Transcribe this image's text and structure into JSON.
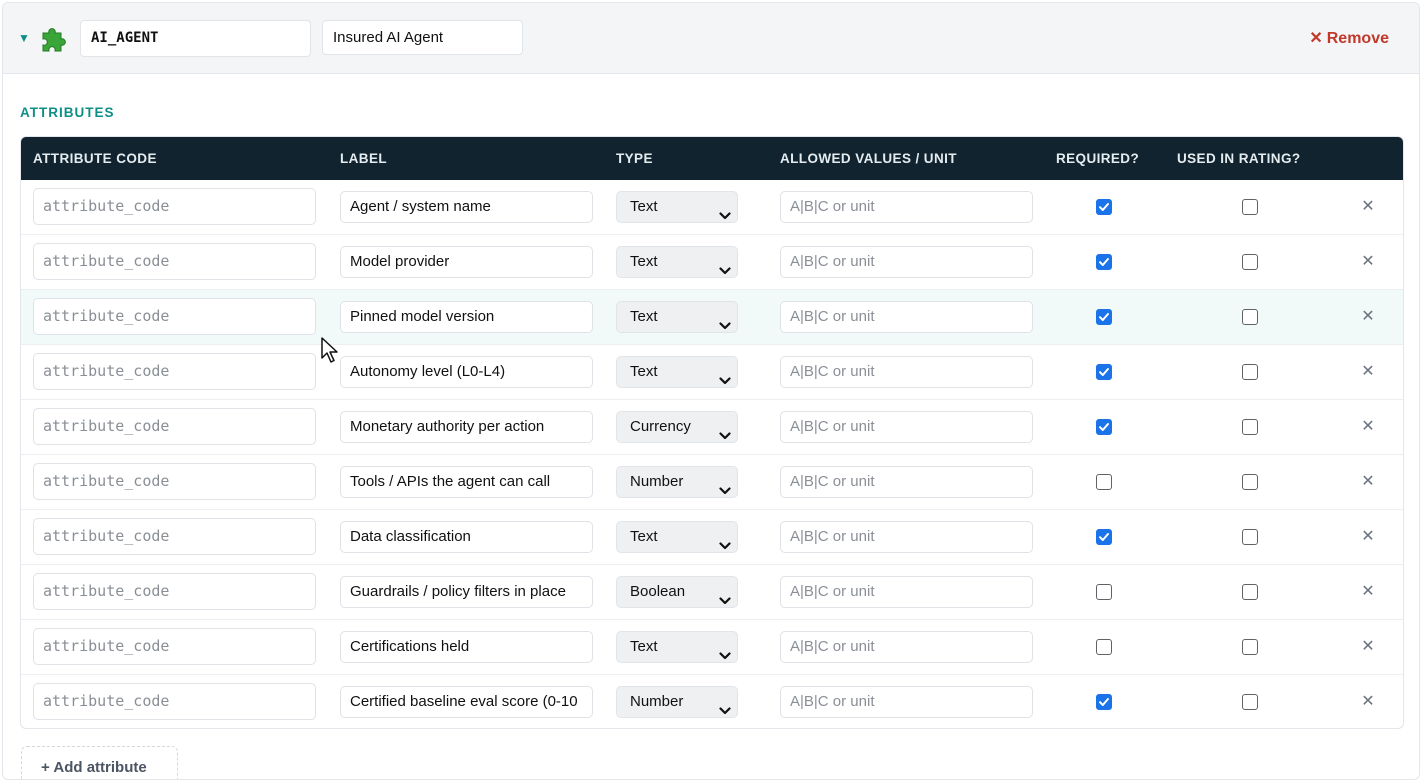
{
  "entity": {
    "expand_icon": "triangle-down-icon",
    "type_icon": "puzzle-piece-icon",
    "code": "AI_AGENT",
    "name": "Insured AI Agent",
    "remove_label": "Remove",
    "remove_icon": "close-icon"
  },
  "attributes_section": {
    "title": "ATTRIBUTES",
    "columns": [
      "ATTRIBUTE CODE",
      "LABEL",
      "TYPE",
      "ALLOWED VALUES / UNIT",
      "REQUIRED?",
      "USED IN RATING?"
    ],
    "rows": [
      {
        "code_placeholder": "attribute_code",
        "label": "Agent / system name",
        "type": "Text",
        "allowed_placeholder": "A|B|C or unit",
        "required": true,
        "used_in_rating": false
      },
      {
        "code_placeholder": "attribute_code",
        "label": "Model provider",
        "type": "Text",
        "allowed_placeholder": "A|B|C or unit",
        "required": true,
        "used_in_rating": false
      },
      {
        "code_placeholder": "attribute_code",
        "label": "Pinned model version",
        "type": "Text",
        "allowed_placeholder": "A|B|C or unit",
        "required": true,
        "used_in_rating": false
      },
      {
        "code_placeholder": "attribute_code",
        "label": "Autonomy level (L0-L4)",
        "type": "Text",
        "allowed_placeholder": "A|B|C or unit",
        "required": true,
        "used_in_rating": false
      },
      {
        "code_placeholder": "attribute_code",
        "label": "Monetary authority per action",
        "type": "Currency",
        "allowed_placeholder": "A|B|C or unit",
        "required": true,
        "used_in_rating": false
      },
      {
        "code_placeholder": "attribute_code",
        "label": "Tools / APIs the agent can call",
        "type": "Number",
        "allowed_placeholder": "A|B|C or unit",
        "required": false,
        "used_in_rating": false
      },
      {
        "code_placeholder": "attribute_code",
        "label": "Data classification",
        "type": "Text",
        "allowed_placeholder": "A|B|C or unit",
        "required": true,
        "used_in_rating": false
      },
      {
        "code_placeholder": "attribute_code",
        "label": "Guardrails / policy filters in place",
        "type": "Boolean",
        "allowed_placeholder": "A|B|C or unit",
        "required": false,
        "used_in_rating": false
      },
      {
        "code_placeholder": "attribute_code",
        "label": "Certifications held",
        "type": "Text",
        "allowed_placeholder": "A|B|C or unit",
        "required": false,
        "used_in_rating": false
      },
      {
        "code_placeholder": "attribute_code",
        "label": "Certified baseline eval score (0-10",
        "type": "Number",
        "allowed_placeholder": "A|B|C or unit",
        "required": true,
        "used_in_rating": false
      }
    ],
    "row_delete_icon": "close-icon",
    "add_label": "+ Add attribute"
  },
  "colors": {
    "accent": "#0e8f86",
    "header_bg": "#11232e",
    "remove": "#c0392b",
    "checkbox": "#1a73e8"
  }
}
